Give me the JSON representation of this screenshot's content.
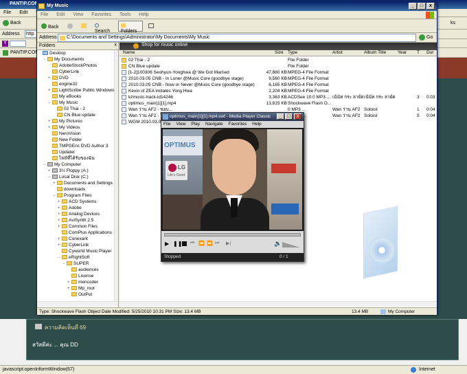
{
  "browser": {
    "title": "PANTIP.COM : ...",
    "menu": [
      "File",
      "Edit",
      "View"
    ],
    "back_label": "Back",
    "address_label": "Address",
    "address_value": "http",
    "tab_label": "PANTIP.COM",
    "right_tool_label": "ks",
    "forum_heading": "ความคิดเห็นที่ 69",
    "forum_line1": "สวัสดีค่ะ ... คุณ DD",
    "status_text": "javascript:openInformWindow(67)",
    "internet_label": "Internet"
  },
  "explorer": {
    "title": "My Music",
    "menu": [
      "File",
      "Edit",
      "View",
      "Favorites",
      "Tools",
      "Help"
    ],
    "toolbar": {
      "back": "Back",
      "search": "Search",
      "folders": "Folders"
    },
    "address_label": "Address",
    "address_value": "C:\\Documents and Settings\\Administrator\\My Documents\\My Music",
    "go_label": "Go",
    "folders_title": "Folders",
    "tree": [
      {
        "label": "Desktop",
        "indent": 0,
        "icon": "blue",
        "exp": ""
      },
      {
        "label": "My Documents",
        "indent": 1,
        "icon": "yellow",
        "exp": "−"
      },
      {
        "label": "AdobeStockPhotos",
        "indent": 2,
        "icon": "yellow",
        "exp": ""
      },
      {
        "label": "CyberLink",
        "indent": 2,
        "icon": "yellow",
        "exp": ""
      },
      {
        "label": "DVD",
        "indent": 2,
        "icon": "yellow",
        "exp": "+"
      },
      {
        "label": "engine32",
        "indent": 2,
        "icon": "yellow",
        "exp": ""
      },
      {
        "label": "LightScribe Public Windows SD",
        "indent": 2,
        "icon": "yellow",
        "exp": "+"
      },
      {
        "label": "My eBooks",
        "indent": 2,
        "icon": "yellow",
        "exp": ""
      },
      {
        "label": "My Music",
        "indent": 2,
        "icon": "yellow",
        "exp": "−"
      },
      {
        "label": "02 Thai - 2",
        "indent": 3,
        "icon": "yellow",
        "exp": ""
      },
      {
        "label": "CN Blue update",
        "indent": 3,
        "icon": "yellow",
        "exp": ""
      },
      {
        "label": "My Pictures",
        "indent": 2,
        "icon": "yellow",
        "exp": "+"
      },
      {
        "label": "My Videos",
        "indent": 2,
        "icon": "yellow",
        "exp": "+"
      },
      {
        "label": "NeroVision",
        "indent": 2,
        "icon": "yellow",
        "exp": ""
      },
      {
        "label": "New Folder",
        "indent": 2,
        "icon": "yellow",
        "exp": ""
      },
      {
        "label": "TMPGEnc DVD Author 3",
        "indent": 2,
        "icon": "yellow",
        "exp": ""
      },
      {
        "label": "Updater",
        "indent": 2,
        "icon": "yellow",
        "exp": ""
      },
      {
        "label": "ไฟล์ที่ได้รับของฉัน",
        "indent": 2,
        "icon": "yellow",
        "exp": ""
      },
      {
        "label": "My Computer",
        "indent": 1,
        "icon": "drive",
        "exp": "−"
      },
      {
        "label": "3½ Floppy (A:)",
        "indent": 2,
        "icon": "drive",
        "exp": "+"
      },
      {
        "label": "Local Disk (C:)",
        "indent": 2,
        "icon": "drive",
        "exp": "−"
      },
      {
        "label": "Documents and Settings",
        "indent": 3,
        "icon": "yellow",
        "exp": "+"
      },
      {
        "label": "downloads",
        "indent": 3,
        "icon": "yellow",
        "exp": ""
      },
      {
        "label": "Program Files",
        "indent": 3,
        "icon": "yellow",
        "exp": "−"
      },
      {
        "label": "ACD Systems",
        "indent": 4,
        "icon": "yellow",
        "exp": "+"
      },
      {
        "label": "Adobe",
        "indent": 4,
        "icon": "yellow",
        "exp": "+"
      },
      {
        "label": "Analog Devices",
        "indent": 4,
        "icon": "yellow",
        "exp": "+"
      },
      {
        "label": "AviSynth 2.5",
        "indent": 4,
        "icon": "yellow",
        "exp": "+"
      },
      {
        "label": "Common Files",
        "indent": 4,
        "icon": "yellow",
        "exp": "+"
      },
      {
        "label": "ComPlus Applications",
        "indent": 4,
        "icon": "yellow",
        "exp": ""
      },
      {
        "label": "Conexant",
        "indent": 4,
        "icon": "yellow",
        "exp": "+"
      },
      {
        "label": "CyberLink",
        "indent": 4,
        "icon": "yellow",
        "exp": "+"
      },
      {
        "label": "Cyworld Music Player",
        "indent": 4,
        "icon": "yellow",
        "exp": ""
      },
      {
        "label": "eRightSoft",
        "indent": 4,
        "icon": "yellow",
        "exp": "−"
      },
      {
        "label": "SUPER",
        "indent": 5,
        "icon": "yellow",
        "exp": "−"
      },
      {
        "label": "audiences",
        "indent": 6,
        "icon": "yellow",
        "exp": ""
      },
      {
        "label": "License",
        "indent": 6,
        "icon": "yellow",
        "exp": ""
      },
      {
        "label": "mencoder",
        "indent": 6,
        "icon": "yellow",
        "exp": "+"
      },
      {
        "label": "Mp_root",
        "indent": 6,
        "icon": "yellow",
        "exp": "+"
      },
      {
        "label": "OutPut",
        "indent": 6,
        "icon": "yellow",
        "exp": ""
      }
    ],
    "banner": "Shop for music online",
    "columns": [
      "Name",
      "Size",
      "Type",
      "Artist",
      "Album Title",
      "Year",
      "T",
      "Dur"
    ],
    "files": [
      {
        "name": "02 Thai - 2",
        "size": "",
        "type": "File Folder",
        "artist": "",
        "album": "",
        "year": "",
        "t": "",
        "dur": ""
      },
      {
        "name": "CN Blue update",
        "size": "",
        "type": "File Folder",
        "artist": "",
        "album": "",
        "year": "",
        "t": "",
        "dur": ""
      },
      {
        "name": "[1-2]100306 Seohyun-Yonghwa @ We Got Married",
        "size": "47,880 KB",
        "type": "MPEG-4 File Format",
        "artist": "",
        "album": "",
        "year": "",
        "t": "",
        "dur": ""
      },
      {
        "name": "2010.03.05 CNB - In Loner @Music Core (goodbye stage)",
        "size": "9,560 KB",
        "type": "MPEG-4 File Format",
        "artist": "",
        "album": "",
        "year": "",
        "t": "",
        "dur": ""
      },
      {
        "name": "2010.03.05 CNB - Now or Never @Music Core (goodbye stage)",
        "size": "6,165 KB",
        "type": "MPEG-4 File Format",
        "artist": "",
        "album": "",
        "year": "",
        "t": "",
        "dur": ""
      },
      {
        "name": "Kevin of ZEA imitates Yong Hwa",
        "size": "2,204 KB",
        "type": "MPEG-4 File Format",
        "artist": "",
        "album": "",
        "year": "",
        "t": "",
        "dur": ""
      },
      {
        "name": "kzmusic-track-id14246",
        "size": "3,363 KB",
        "type": "ACDSee 10.0 MP3 ...",
        "artist": "เน้นัท กระ ลาย์ต",
        "album": "เน้นัท กระ ลาย์ต",
        "year": "",
        "t": "3",
        "dur": "0:03"
      },
      {
        "name": "optimus_main[1][1].mp4",
        "size": "13,815 KB",
        "type": "Shockwave Flash O...",
        "artist": "",
        "album": "",
        "year": "",
        "t": "",
        "dur": ""
      },
      {
        "name": "Wan ว่าน AF2 - ขอบ...",
        "size": "",
        "type": "0 MP3 ...",
        "artist": "Wan ว่าน AF2",
        "album": "Soloist",
        "year": "",
        "t": "1",
        "dur": "0:04"
      },
      {
        "name": "Wan ว่าน AF2 - ใจเธ...",
        "size": "",
        "type": "0 MP3 ...",
        "artist": "Wan ว่าน AF2",
        "album": "Soloist",
        "year": "",
        "t": "5",
        "dur": "0:04"
      },
      {
        "name": "WGM 2010.03.06 S...",
        "size": "",
        "type": "Format",
        "artist": "",
        "album": "",
        "year": "",
        "t": "",
        "dur": ""
      }
    ],
    "status_text": "Type: Shockwave Flash Object Date Modified: 5/25/2010 10:31 PM Size: 13.4 MB",
    "status_size": "13.4 MB",
    "status_location": "My Computer"
  },
  "player": {
    "title": "optimus_main[1][1].mp4.swf - Media Player Classic",
    "menu": [
      "File",
      "View",
      "Play",
      "Navigate",
      "Favorites",
      "Help"
    ],
    "status": "Stopped",
    "counter": "0 / 1",
    "video_text_brand": "OPTIMUS",
    "video_text_logo": "LG",
    "video_text_tag": "Life's Good"
  }
}
